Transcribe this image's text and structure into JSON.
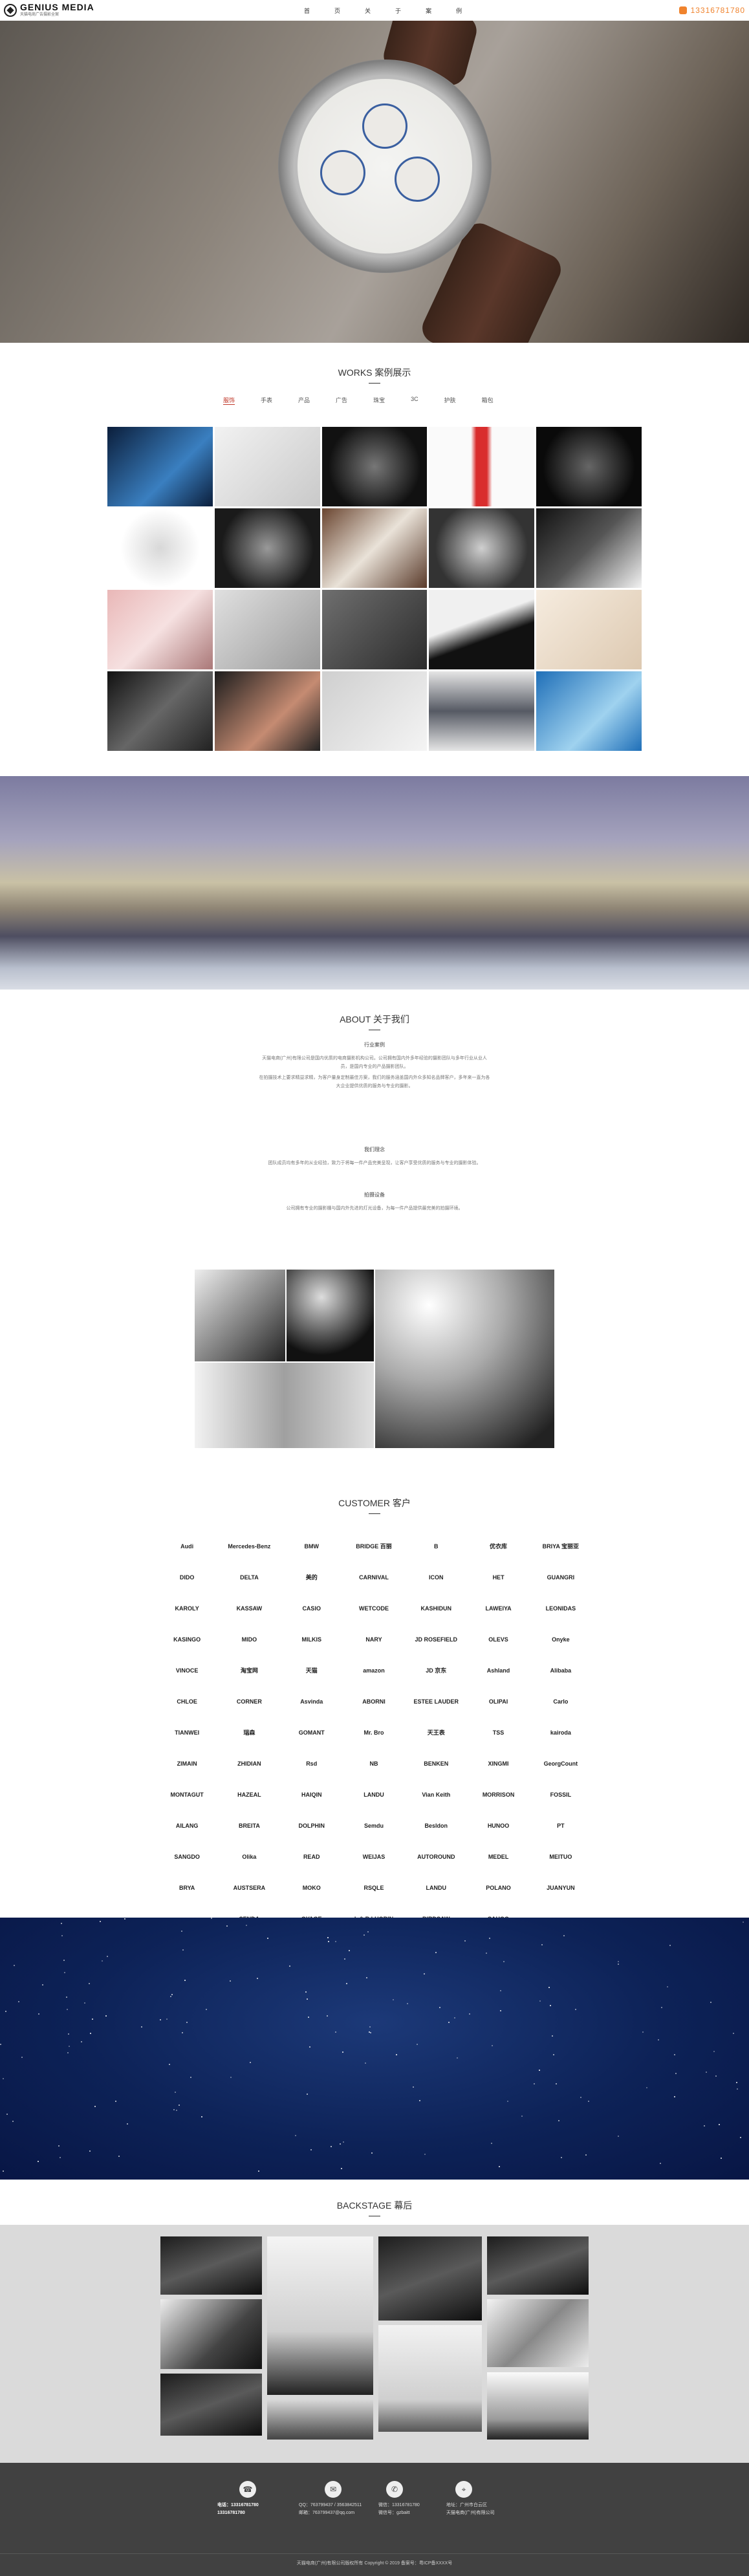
{
  "header": {
    "logo_name": "GENIUS MEDIA",
    "logo_sub": "天猫电商广告摄影全案",
    "nav": [
      "首",
      "页",
      "关",
      "于",
      "案",
      "例"
    ],
    "phone": "13316781780"
  },
  "banner": {
    "slides": 5,
    "active_slide": 1
  },
  "works": {
    "title": "WORKS 案例展示",
    "tabs": [
      "服饰",
      "手表",
      "产品",
      "广告",
      "珠宝",
      "3C",
      "护肤",
      "箱包"
    ],
    "active_tab": 0
  },
  "about": {
    "title": "ABOUT 关于我们",
    "h1": "行业案例",
    "p1": "天猫电商(广州)有限公司是国内优质的电商摄影机构公司。公司拥有国内外多年经验的摄影团队与多年行业从业人员，是国内专业的产品摄影团队。",
    "p2": "在拍摄技术上要求精益求精，为客户量身定制最佳方案，我们的服务涵盖国内外众多知名品牌客户，多年来一直为各大企业提供优质的服务与专业的摄影。",
    "h2": "我们理念",
    "p3": "团队成员均有多年的从业经验，致力于将每一件产品完美呈现，让客户享受优质的服务与专业的摄影体验。",
    "h3": "拍摄设备",
    "p4": "公司拥有专业的摄影棚与国内外先进的灯光设备，为每一件产品提供最完美的拍摄环境。"
  },
  "customer": {
    "title": "CUSTOMER 客户",
    "logos": [
      "Audi",
      "Mercedes-Benz",
      "BMW",
      "BRIDGE 百丽",
      "B",
      "优衣库",
      "BRIYA 宝丽亚",
      "DIDO",
      "DELTA",
      "美的",
      "CARNIVAL",
      "ICON",
      "HET",
      "GUANGRI",
      "KAROLY",
      "KASSAW",
      "CASIO",
      "WETCODE",
      "KASHIDUN",
      "LAWEIYA",
      "LEONIDAS",
      "KASINGO",
      "MIDO",
      "MILKIS",
      "NARY",
      "JD ROSEFIELD",
      "OLEVS",
      "Onyke",
      "VINOCE",
      "淘宝网",
      "天猫",
      "amazon",
      "JD 京东",
      "Ashland",
      "Alibaba",
      "CHLOE",
      "CORNER",
      "Asvinda",
      "ABORNI",
      "ESTEE LAUDER",
      "OLIPAI",
      "Carlo",
      "TIANWEI",
      "瑞森",
      "GOMANT",
      "Mr. Bro",
      "天王表",
      "TSS",
      "kairoda",
      "ZIMAIN",
      "ZHIDIAN",
      "Rsd",
      "NB",
      "BENKEN",
      "XINGMI",
      "GeorgCount",
      "MONTAGUT",
      "HAZEAL",
      "HAIQIN",
      "LANDU",
      "Vian Keith",
      "MORRISON",
      "FOSSIL",
      "AILANG",
      "BREITA",
      "DOLPHIN",
      "Semdu",
      "Besldon",
      "HUNOO",
      "PT",
      "SANGDO",
      "Olika",
      "READ",
      "WEIJAS",
      "AUTOROUND",
      "MEDEL",
      "MEITUO",
      "BRYA",
      "AUSTSERA",
      "MOKO",
      "RSQLE",
      "LANDU",
      "POLANO",
      "JUANYUN",
      "vogue",
      "SENDA",
      "OYAGE",
      "L & B LUOBIN",
      "BIRDSAW",
      "SAHOO",
      ""
    ]
  },
  "backstage": {
    "title": "BACKSTAGE 幕后"
  },
  "footer": {
    "phone_label": "电话：13316781780",
    "phone_label2": "13316781780",
    "qq": "QQ：763799437 / 3563842511",
    "email": "邮箱：763799437@qq.com",
    "wechat": "微信：13316781780",
    "wechat2": "微信号：gzbaitt",
    "addr": "地址：广州市白云区",
    "addr2": "天猫电商(广州)有限公司",
    "copyright": "天猫电商(广州)有限公司版权所有 Copyright © 2019 备案号：粤ICP备XXXX号"
  },
  "colors": {
    "accent": "#f0832d",
    "tab_active": "#c0392b",
    "footer_bg": "#414141",
    "stars_bg": "#0d2257"
  }
}
